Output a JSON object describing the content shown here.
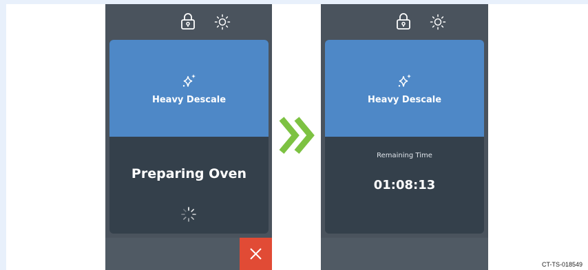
{
  "screens": [
    {
      "program_title": "Heavy Descale",
      "status_title": "Preparing Oven"
    },
    {
      "program_title": "Heavy Descale",
      "remaining_label": "Remaining Time",
      "remaining_time": "01:08:13"
    }
  ],
  "caption": "CT-TS-018549",
  "icons": {
    "lock": "lock-icon",
    "brightness": "sun-icon",
    "program": "sparkle-icon",
    "loading": "spinner-icon",
    "cancel": "close-icon",
    "next": "double-chevron-right-icon"
  },
  "colors": {
    "accent_blue": "#4e88c7",
    "screen_dark": "#34404b",
    "cancel_red": "#e14b35",
    "arrow_green": "#7dc242"
  }
}
